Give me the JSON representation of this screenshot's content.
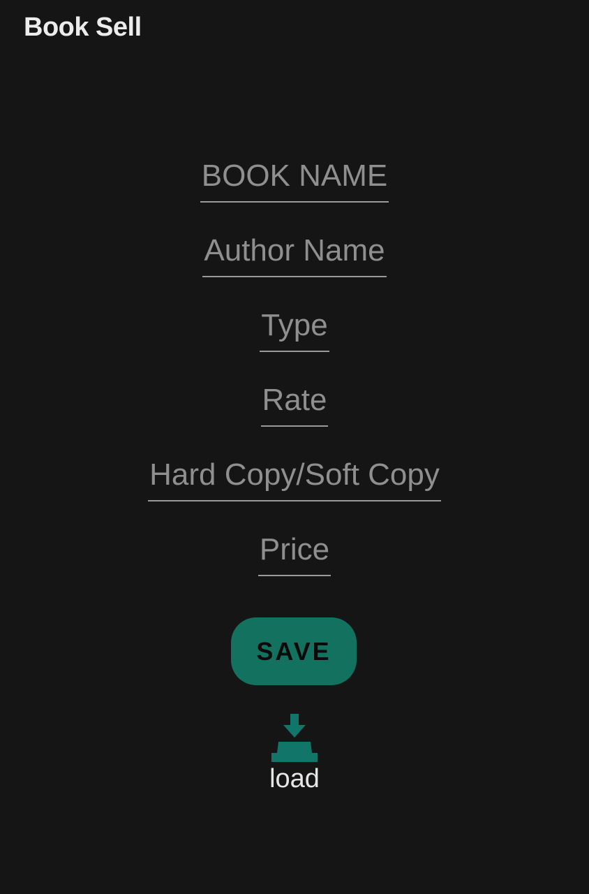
{
  "app": {
    "title": "Book Sell"
  },
  "form": {
    "fields": [
      {
        "placeholder": "BOOK NAME",
        "value": ""
      },
      {
        "placeholder": "Author Name",
        "value": ""
      },
      {
        "placeholder": "Type",
        "value": ""
      },
      {
        "placeholder": "Rate",
        "value": ""
      },
      {
        "placeholder": "Hard Copy/Soft Copy",
        "value": ""
      },
      {
        "placeholder": "Price",
        "value": ""
      }
    ],
    "save_label": "SAVE"
  },
  "load": {
    "label": "load",
    "icon": "download-icon"
  },
  "colors": {
    "background": "#151515",
    "accent": "#12725f",
    "placeholder_text": "#8f8f8f",
    "underline": "#9a9a9a",
    "title_text": "#ececec"
  }
}
